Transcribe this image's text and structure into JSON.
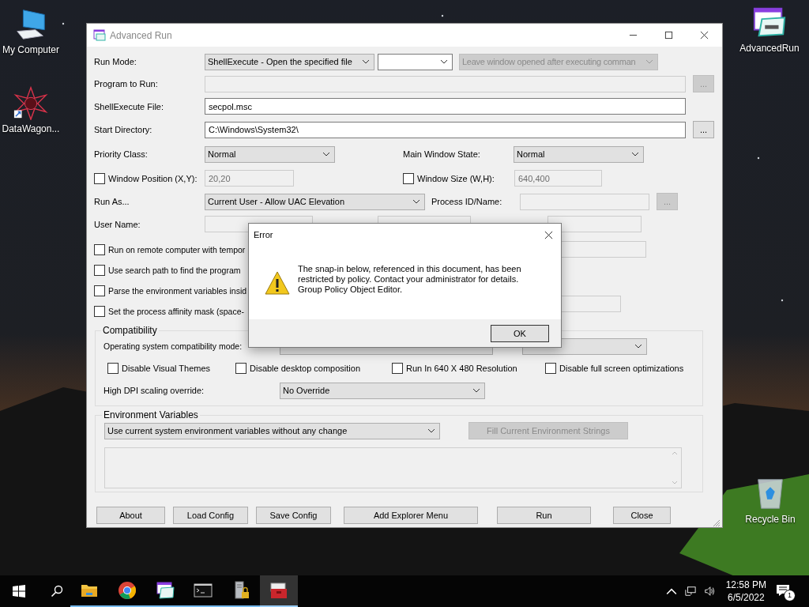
{
  "desktop_icons": [
    {
      "kind": "computer",
      "label": "My Computer"
    },
    {
      "kind": "shortcut",
      "label": "DataWagon..."
    },
    {
      "kind": "app",
      "label": "AdvancedRun"
    },
    {
      "kind": "recycle-bin",
      "label": "Recycle Bin"
    }
  ],
  "window": {
    "title": "Advanced Run"
  },
  "run_mode": {
    "label": "Run Mode:",
    "value": "ShellExecute - Open the specified file"
  },
  "run_mode_extra": {
    "disabled": false
  },
  "leave_window": {
    "value": "Leave window opened after executing comman",
    "disabled": true
  },
  "program_to_run": {
    "label": "Program to Run:",
    "disabled": true,
    "browse": {
      "label": "...",
      "disabled": true
    }
  },
  "shellexecute_file": {
    "label": "ShellExecute File:",
    "value": "secpol.msc"
  },
  "start_directory": {
    "label": "Start Directory:",
    "value": "C:\\Windows\\System32\\",
    "browse": {
      "label": "...",
      "disabled": false
    }
  },
  "priority_class": {
    "label": "Priority Class:",
    "value": "Normal"
  },
  "main_window_state": {
    "label": "Main Window State:",
    "value": "Normal"
  },
  "window_position": {
    "label": "Window Position (X,Y):",
    "checked": false,
    "value": "20,20",
    "disabled": true
  },
  "window_size": {
    "label": "Window Size (W,H):",
    "checked": false,
    "value": "640,400",
    "disabled": true
  },
  "run_as": {
    "label": "Run As...",
    "value": "Current User - Allow UAC Elevation"
  },
  "process_id": {
    "label": "Process ID/Name:",
    "disabled": true,
    "browse": {
      "label": "...",
      "disabled": true
    }
  },
  "user_name": {
    "label": "User Name:"
  },
  "options": [
    {
      "label": "Run on remote computer with tempor",
      "checked": false
    },
    {
      "label": "Use search path to find the program",
      "checked": false
    },
    {
      "label": "Parse the environment variables insid",
      "checked": false
    },
    {
      "label": "Set the process affinity mask (space-",
      "checked": false
    }
  ],
  "compatibility": {
    "title": "Compatibility",
    "os_mode": {
      "label": "Operating system compatibility mode:"
    },
    "options": [
      {
        "label": "Disable Visual Themes",
        "checked": false
      },
      {
        "label": "Disable desktop composition",
        "checked": false
      },
      {
        "label": "Run In 640 X 480 Resolution",
        "checked": false
      },
      {
        "label": "Disable full screen optimizations",
        "checked": false
      }
    ],
    "high_dpi": {
      "label": "High DPI scaling override:",
      "value": "No Override"
    }
  },
  "environment": {
    "title": "Environment Variables",
    "mode": {
      "value": "Use current system environment variables without any change"
    },
    "fill_button": {
      "label": "Fill Current Environment Strings",
      "disabled": true
    }
  },
  "buttons": [
    {
      "label": "About"
    },
    {
      "label": "Load Config"
    },
    {
      "label": "Save Config"
    },
    {
      "label": "Add Explorer Menu"
    },
    {
      "label": "Run"
    },
    {
      "label": "Close"
    }
  ],
  "dialog": {
    "title": "Error",
    "message": "The snap-in below, referenced in this document, has been\nrestricted by policy. Contact your administrator for details.\nGroup Policy Object Editor.",
    "ok": "OK"
  },
  "taskbar": {
    "apps": [
      {
        "kind": "folder",
        "selected": false
      },
      {
        "kind": "browser",
        "selected": false
      },
      {
        "kind": "app",
        "selected": false
      },
      {
        "kind": "terminal",
        "selected": false
      },
      {
        "kind": "server",
        "selected": false
      },
      {
        "kind": "toolbox",
        "selected": true
      }
    ],
    "time": "12:58 PM",
    "date": "6/5/2022",
    "notifications": "1"
  }
}
